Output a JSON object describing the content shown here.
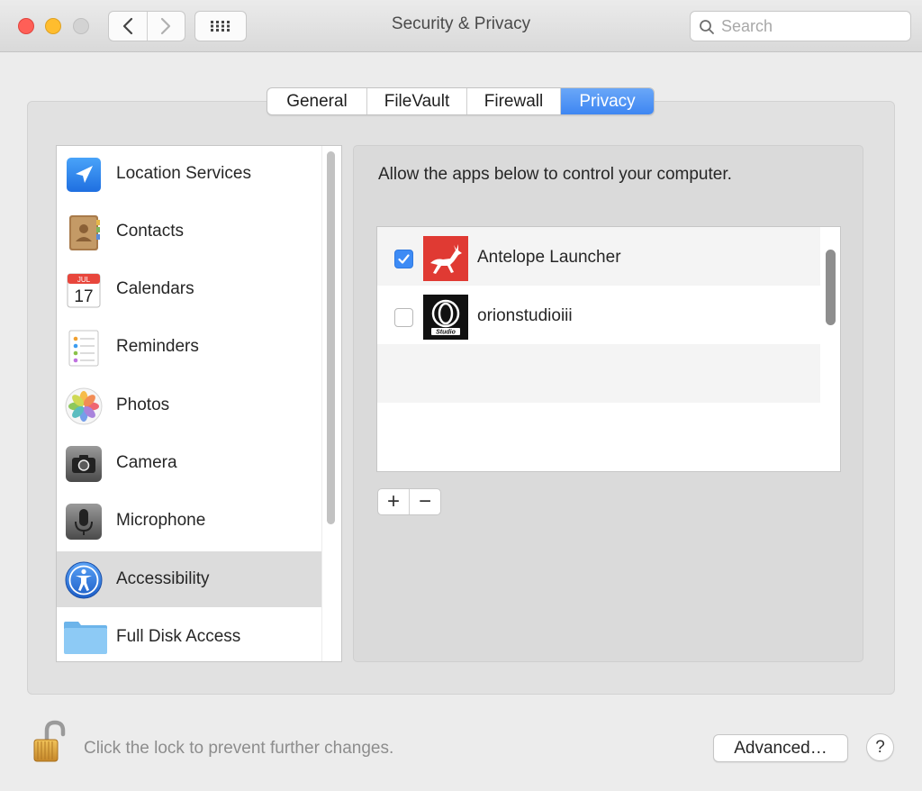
{
  "window": {
    "title": "Security & Privacy"
  },
  "toolbar": {
    "back_icon": "chevron-left-icon",
    "forward_icon": "chevron-right-icon",
    "show_all_icon": "grid-icon"
  },
  "search": {
    "placeholder": "Search",
    "value": ""
  },
  "tabs": [
    {
      "label": "General",
      "active": false
    },
    {
      "label": "FileVault",
      "active": false
    },
    {
      "label": "Firewall",
      "active": false
    },
    {
      "label": "Privacy",
      "active": true
    }
  ],
  "sidebar": {
    "selected": "Accessibility",
    "items": [
      {
        "label": "Location Services",
        "icon": "location-arrow-icon"
      },
      {
        "label": "Contacts",
        "icon": "contacts-book-icon"
      },
      {
        "label": "Calendars",
        "icon": "calendar-icon",
        "icon_month": "JUL",
        "icon_day": "17"
      },
      {
        "label": "Reminders",
        "icon": "reminders-list-icon"
      },
      {
        "label": "Photos",
        "icon": "photos-flower-icon"
      },
      {
        "label": "Camera",
        "icon": "camera-icon"
      },
      {
        "label": "Microphone",
        "icon": "microphone-icon"
      },
      {
        "label": "Accessibility",
        "icon": "accessibility-icon"
      },
      {
        "label": "Full Disk Access",
        "icon": "folder-icon"
      }
    ]
  },
  "main": {
    "description": "Allow the apps below to control your computer.",
    "apps": [
      {
        "name": "Antelope Launcher",
        "checked": true,
        "icon": "antelope-icon"
      },
      {
        "name": "orionstudioiii",
        "checked": false,
        "icon": "orion-studio-icon",
        "icon_text": "Studio"
      }
    ],
    "add_label": "+",
    "remove_label": "−"
  },
  "footer": {
    "lock_message": "Click the lock to prevent further changes.",
    "advanced_label": "Advanced…",
    "help_label": "?"
  },
  "colors": {
    "accent": "#3d8bf5",
    "close": "#ff5f57",
    "minimize": "#ffbd2e",
    "antelope_red": "#e03a33"
  }
}
